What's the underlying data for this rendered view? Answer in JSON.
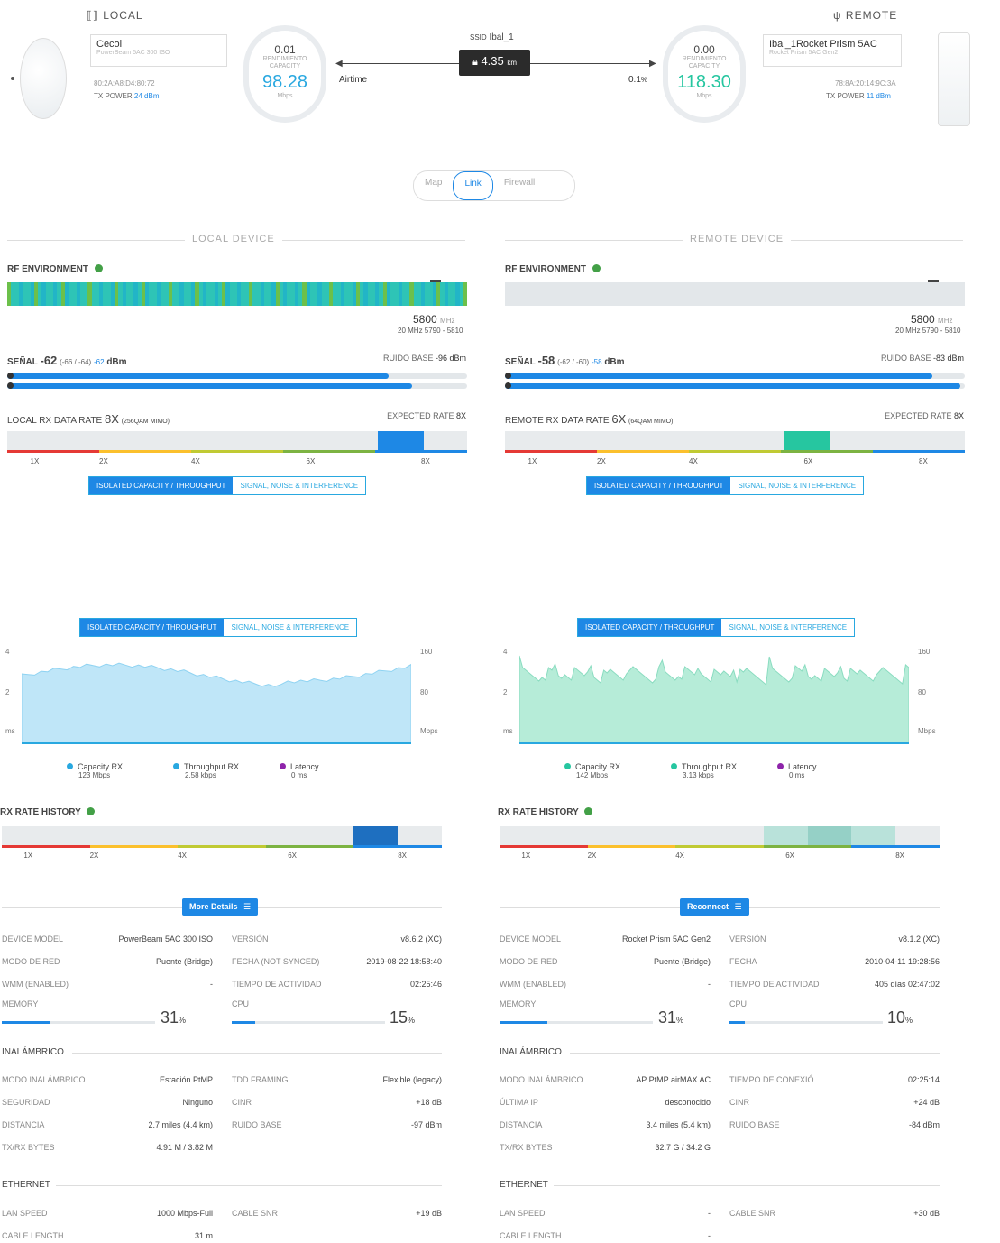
{
  "header": {
    "local_title": "LOCAL",
    "remote_title": "REMOTE",
    "ssid_label": "SSID",
    "ssid_value": "Ibal_1",
    "distance_value": "4.35",
    "distance_unit": "km",
    "airtime_label": "Airtime",
    "airtime_value": "0.1",
    "airtime_unit": "%"
  },
  "local_device": {
    "name": "Cecol",
    "model": "PowerBeam 5AC 300 ISO",
    "mac": "80:2A:A8:D4:80:72",
    "tx_power_label": "TX POWER",
    "tx_power_value": "24 dBm",
    "throughput": "0.01",
    "throughput_label": "RENDIMIENTO",
    "capacity_label": "CAPACITY",
    "capacity_value": "98.28",
    "capacity_unit": "Mbps"
  },
  "remote_device": {
    "name": "Ibal_1Rocket Prism 5AC",
    "model": "Rocket Prism 5AC Gen2",
    "mac": "78:8A:20:14:9C:3A",
    "tx_power_label": "TX POWER",
    "tx_power_value": "11 dBm",
    "throughput": "0.00",
    "throughput_label": "RENDIMIENTO",
    "capacity_label": "CAPACITY",
    "capacity_value": "118.30",
    "capacity_unit": "Mbps"
  },
  "view_toggle": {
    "options": [
      "Map",
      "Link",
      "Firewall"
    ],
    "selected": "Link"
  },
  "local": {
    "section_label": "LOCAL DEVICE",
    "rf_label": "RF ENVIRONMENT",
    "freq_value": "5800",
    "freq_unit": "MHz",
    "freq_range": "20 MHz 5790 - 5810",
    "signal_label": "SEÑAL",
    "signal_value": "-62",
    "signal_chains": "(-66 / -64)",
    "signal_extra": "-62",
    "signal_unit": "dBm",
    "noise_label": "RUIDO BASE",
    "noise_value": "-96 dBm",
    "signal_bar_1": 0.83,
    "signal_bar_2": 0.88,
    "rate_label": "LOCAL RX DATA RATE",
    "rate_value": "8X",
    "rate_mod": "(256QAM MIMO)",
    "expected_label": "EXPECTED RATE",
    "expected_value": "8X",
    "rate_ticks": [
      "1X",
      "2X",
      "4X",
      "6X",
      "8X"
    ],
    "tab_a": "ISOLATED CAPACITY / THROUGHPUT",
    "tab_b": "SIGNAL, NOISE & INTERFERENCE",
    "chart_axis_left": [
      "4",
      "2",
      "ms"
    ],
    "chart_axis_right": [
      "160",
      "80",
      "Mbps"
    ],
    "legend": [
      {
        "name": "Capacity RX",
        "value": "123 Mbps"
      },
      {
        "name": "Throughput RX",
        "value": "2.58 kbps"
      },
      {
        "name": "Latency",
        "value": "0 ms"
      }
    ],
    "history_label": "RX RATE HISTORY",
    "history_ticks": [
      "1X",
      "2X",
      "4X",
      "6X",
      "8X"
    ],
    "action_button": "More Details",
    "details": {
      "device_model_label": "DEVICE MODEL",
      "device_model": "PowerBeam 5AC 300 ISO",
      "version_label": "VERSIÓN",
      "version": "v8.6.2 (XC)",
      "network_mode_label": "MODO DE RED",
      "network_mode": "Puente (Bridge)",
      "date_label": "FECHA (NOT SYNCED)",
      "date": "2019-08-22 18:58:40",
      "wmm_label": "WMM (ENABLED)",
      "wmm": "-",
      "uptime_label": "TIEMPO DE ACTIVIDAD",
      "uptime": "02:25:46",
      "memory_label": "MEMORY",
      "memory_value": "31",
      "memory_fraction": 0.31,
      "cpu_label": "CPU",
      "cpu_value": "15",
      "cpu_fraction": 0.15,
      "pct_unit": "%"
    },
    "wireless": {
      "title": "INALÁMBRICO",
      "rows": [
        {
          "k1": "MODO INALÁMBRICO",
          "v1": "Estación PtMP",
          "k2": "TDD FRAMING",
          "v2": "Flexible (legacy)"
        },
        {
          "k1": "SEGURIDAD",
          "v1": "Ninguno",
          "k2": "CINR",
          "v2": "+18 dB"
        },
        {
          "k1": "DISTANCIA",
          "v1": "2.7 miles (4.4 km)",
          "k2": "RUIDO BASE",
          "v2": "-97 dBm"
        },
        {
          "k1": "TX/RX BYTES",
          "v1": "4.91 M / 3.82 M",
          "k2": "",
          "v2": ""
        }
      ]
    },
    "ethernet": {
      "title": "ETHERNET",
      "rows": [
        {
          "k1": "LAN SPEED",
          "v1": "1000 Mbps-Full",
          "k2": "CABLE SNR",
          "v2": "+19 dB"
        },
        {
          "k1": "CABLE LENGTH",
          "v1": "31 m",
          "k2": "",
          "v2": ""
        }
      ]
    }
  },
  "remote": {
    "section_label": "REMOTE DEVICE",
    "rf_label": "RF ENVIRONMENT",
    "freq_value": "5800",
    "freq_unit": "MHz",
    "freq_range": "20 MHz 5790 - 5810",
    "signal_label": "SEÑAL",
    "signal_value": "-58",
    "signal_chains": "(-62 / -60)",
    "signal_extra": "-58",
    "signal_unit": "dBm",
    "noise_label": "RUIDO BASE",
    "noise_value": "-83 dBm",
    "signal_bar_1": 0.93,
    "signal_bar_2": 0.99,
    "rate_label": "REMOTE RX DATA RATE",
    "rate_value": "6X",
    "rate_mod": "(64QAM MIMO)",
    "expected_label": "EXPECTED RATE",
    "expected_value": "8X",
    "rate_ticks": [
      "1X",
      "2X",
      "4X",
      "6X",
      "8X"
    ],
    "tab_a": "ISOLATED CAPACITY / THROUGHPUT",
    "tab_b": "SIGNAL, NOISE & INTERFERENCE",
    "chart_axis_left": [
      "4",
      "2",
      "ms"
    ],
    "chart_axis_right": [
      "160",
      "80",
      "Mbps"
    ],
    "legend": [
      {
        "name": "Capacity RX",
        "value": "142 Mbps"
      },
      {
        "name": "Throughput RX",
        "value": "3.13 kbps"
      },
      {
        "name": "Latency",
        "value": "0 ms"
      }
    ],
    "history_label": "RX RATE HISTORY",
    "history_ticks": [
      "1X",
      "2X",
      "4X",
      "6X",
      "8X"
    ],
    "action_button": "Reconnect",
    "details": {
      "device_model_label": "DEVICE MODEL",
      "device_model": "Rocket Prism 5AC Gen2",
      "version_label": "VERSIÓN",
      "version": "v8.1.2 (XC)",
      "network_mode_label": "MODO DE RED",
      "network_mode": "Puente (Bridge)",
      "date_label": "FECHA",
      "date": "2010-04-11 19:28:56",
      "wmm_label": "WMM (ENABLED)",
      "wmm": "-",
      "uptime_label": "TIEMPO DE ACTIVIDAD",
      "uptime": "405 días 02:47:02",
      "memory_label": "MEMORY",
      "memory_value": "31",
      "memory_fraction": 0.31,
      "cpu_label": "CPU",
      "cpu_value": "10",
      "cpu_fraction": 0.1,
      "pct_unit": "%"
    },
    "wireless": {
      "title": "INALÁMBRICO",
      "rows": [
        {
          "k1": "MODO INALÁMBRICO",
          "v1": "AP PtMP airMAX AC",
          "k2": "TIEMPO DE CONEXIÓ",
          "v2": "02:25:14"
        },
        {
          "k1": "ÚLTIMA IP",
          "v1": "desconocido",
          "k2": "CINR",
          "v2": "+24 dB"
        },
        {
          "k1": "DISTANCIA",
          "v1": "3.4 miles (5.4 km)",
          "k2": "RUIDO BASE",
          "v2": "-84 dBm"
        },
        {
          "k1": "TX/RX BYTES",
          "v1": "32.7 G / 34.2 G",
          "k2": "",
          "v2": ""
        }
      ]
    },
    "ethernet": {
      "title": "ETHERNET",
      "rows": [
        {
          "k1": "LAN SPEED",
          "v1": "-",
          "k2": "CABLE SNR",
          "v2": "+30 dB"
        },
        {
          "k1": "CABLE LENGTH",
          "v1": "-",
          "k2": "",
          "v2": ""
        }
      ]
    }
  },
  "colors": {
    "accent": "#1e88e5",
    "capacity_local": "#29a8e0",
    "capacity_remote": "#26c6a0",
    "latency": "#8e24aa",
    "rf_bar_local": "#2ec4b6",
    "rf_bar_remote": "#e3e7ea"
  }
}
